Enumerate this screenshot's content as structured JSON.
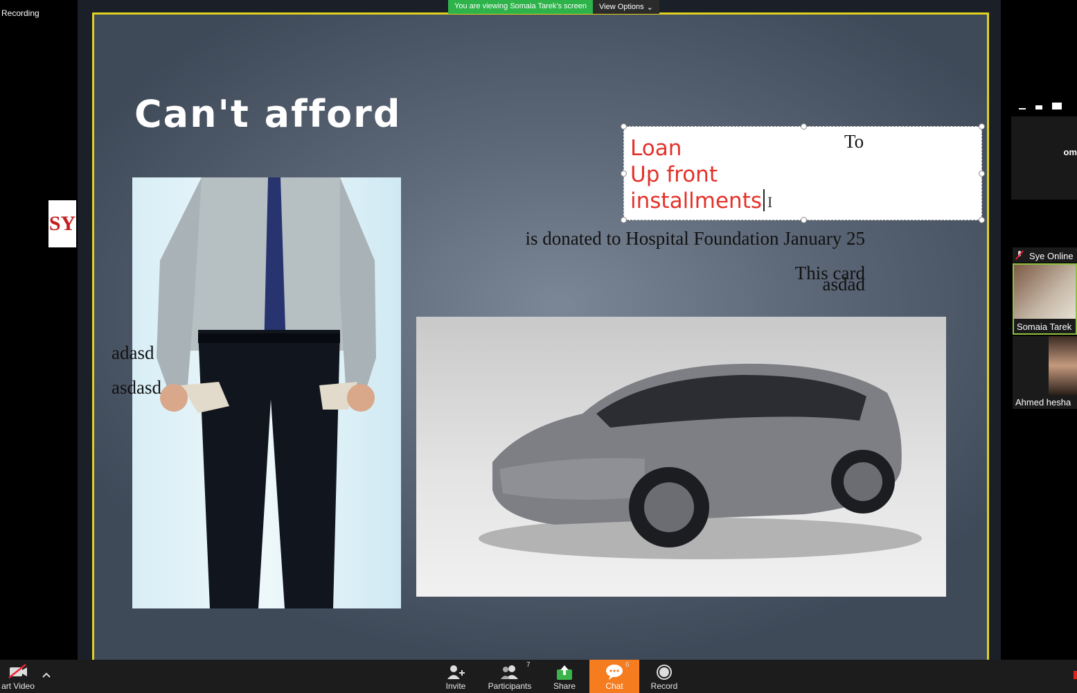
{
  "recording_label": "Recording",
  "banner": {
    "viewing_text": "You are viewing Somaia Tarek's screen",
    "view_options_label": "View Options",
    "chevron": "⌄"
  },
  "slide": {
    "title": "Can't afford",
    "textbox": {
      "lines": [
        "Loan",
        "Up front",
        "installments"
      ],
      "to_text": "To",
      "cursor_glyph": "I"
    },
    "donated_text": "is donated to Hospital Foundation January 25",
    "card_text": "This card",
    "asdad_text": "asdad",
    "adasd_text": "adasd",
    "asdasd_text": "asdasd"
  },
  "gallery": {
    "partial_text": "om",
    "logo_text": "SY",
    "participants": [
      {
        "name": "Sye Online"
      },
      {
        "name": "Somaia Tarek"
      },
      {
        "name": "Ahmed hesha"
      }
    ]
  },
  "toolbar": {
    "start_video_label": "art Video",
    "invite_label": "Invite",
    "participants_label": "Participants",
    "participants_count": "7",
    "share_label": "Share",
    "chat_label": "Chat",
    "chat_count": "6",
    "record_label": "Record"
  },
  "colors": {
    "accent_green": "#2db34a",
    "slide_border": "#e2d21d",
    "chat_orange": "#f57c1f",
    "textbox_red": "#e4312a"
  },
  "icons": [
    "video-off-icon",
    "caret-up-icon",
    "invite-icon",
    "participants-icon",
    "share-icon",
    "chat-icon",
    "record-icon",
    "muted-mic-icon"
  ]
}
